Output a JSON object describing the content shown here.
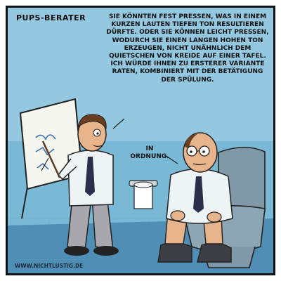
{
  "comic": {
    "title": "Pups-Berater",
    "advisor_speech": "Sie könnten fest pressen, was in einem kurzen lauten tiefen Ton resultieren dürfte. Oder Sie können leicht pressen, wodurch Sie einen langen hohen Ton erzeugen, nicht unähnlich dem Quietschen von Kreide auf einer Tafel. Ich würde Ihnen zu ersterer Variante raten, kombiniert mit der Betätigung der Spülung.",
    "client_speech": "In Ordnung.",
    "credit": "www.nichtlustig.de"
  },
  "colors": {
    "background_wall": "#7ab9d6",
    "floor": "#4f8fb5",
    "shirt": "#eef3f6",
    "tie": "#2b2f4a",
    "pants": "#3d3d45",
    "skin": "#e8b48c",
    "toilet": "#7f99a8"
  },
  "icons": [
    "flipchart",
    "toilet-paper-roll",
    "toilet"
  ]
}
